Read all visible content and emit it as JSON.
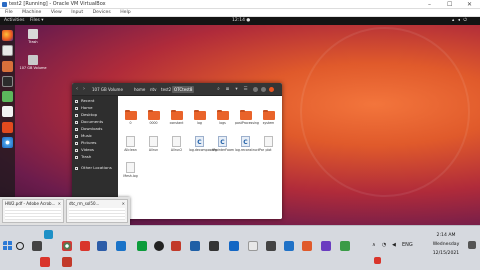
{
  "vbox": {
    "title": "test2 [Running] - Oracle VM VirtualBox",
    "menu": [
      "File",
      "Machine",
      "View",
      "Input",
      "Devices",
      "Help"
    ],
    "controls": [
      "–",
      "☐",
      "✕"
    ]
  },
  "ubuntu": {
    "activities": "Activities",
    "app_menu": "Files ▾",
    "clock": "12:14 ●",
    "desktop_icons": [
      {
        "label": "Trash",
        "color": "#d8d8d8"
      },
      {
        "label": "107 GB Volume",
        "color": "#c9c9c9"
      }
    ]
  },
  "nautilus": {
    "nav_back": "‹",
    "nav_fwd": "›",
    "crumbs": [
      "107 GB Volume",
      "home",
      "ntv",
      "test2",
      "OTCtest8"
    ],
    "sidebar": [
      "Recent",
      "Home",
      "Desktop",
      "Documents",
      "Downloads",
      "Music",
      "Pictures",
      "Videos",
      "Trash",
      "Other Locations"
    ],
    "files": [
      {
        "name": "0",
        "type": "folder"
      },
      {
        "name": "0000",
        "type": "folder"
      },
      {
        "name": "constant",
        "type": "folder"
      },
      {
        "name": "log",
        "type": "folder"
      },
      {
        "name": "logs",
        "type": "folder"
      },
      {
        "name": "postProcessing",
        "type": "folder"
      },
      {
        "name": "system",
        "type": "folder"
      },
      {
        "name": "Allclean",
        "type": "doc"
      },
      {
        "name": "Allrun",
        "type": "doc"
      },
      {
        "name": "Allrun2",
        "type": "doc"
      },
      {
        "name": "log.decomposePar",
        "type": "c"
      },
      {
        "name": "log.interFoam",
        "type": "c"
      },
      {
        "name": "log.reconstructPar",
        "type": "c"
      },
      {
        "name": "plot",
        "type": "doc"
      },
      {
        "name": "Mesh.log",
        "type": "doc"
      }
    ]
  },
  "thumbnails": [
    {
      "title": "HW2.pdf - Adobe Acrob...",
      "close": "✕"
    },
    {
      "title": "dtc_rm_sol50...",
      "close": "✕"
    }
  ],
  "windows": {
    "time": "2:14 AM",
    "day": "Wednesday",
    "date": "12/15/2021",
    "tray_text": "ENG"
  }
}
